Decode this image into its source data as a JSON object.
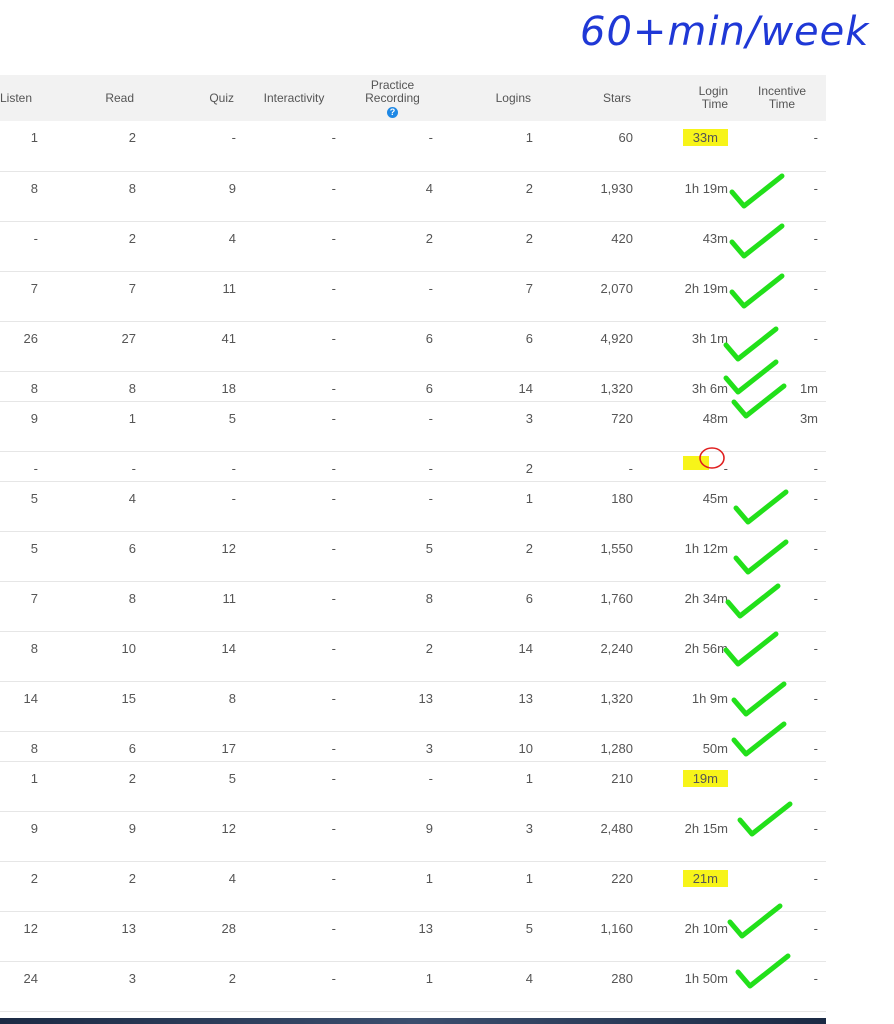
{
  "annotation": {
    "text": "60+min/week",
    "color": "#1f38d6"
  },
  "colors": {
    "highlight": "#f7f419",
    "check": "#22e01a",
    "circle": "#e02020",
    "help": "#1e88e5"
  },
  "columns": {
    "listen": "Listen",
    "read": "Read",
    "quiz": "Quiz",
    "interactivity": "Interactivity",
    "practice_line1": "Practice",
    "practice_line2": "Recording",
    "logins": "Logins",
    "stars": "Stars",
    "login_time_line1": "Login",
    "login_time_line2": "Time",
    "incentive_line1": "Incentive",
    "incentive_line2": "Time"
  },
  "help_icon": "?",
  "rows": [
    {
      "listen": "1",
      "read": "2",
      "quiz": "-",
      "interactivity": "-",
      "practice": "-",
      "logins": "1",
      "stars": "60",
      "login_time": "33m",
      "incentive": "-"
    },
    {
      "listen": "8",
      "read": "8",
      "quiz": "9",
      "interactivity": "-",
      "practice": "4",
      "logins": "2",
      "stars": "1,930",
      "login_time": "1h 19m",
      "incentive": "-"
    },
    {
      "listen": "-",
      "read": "2",
      "quiz": "4",
      "interactivity": "-",
      "practice": "2",
      "logins": "2",
      "stars": "420",
      "login_time": "43m",
      "incentive": "-"
    },
    {
      "listen": "7",
      "read": "7",
      "quiz": "11",
      "interactivity": "-",
      "practice": "-",
      "logins": "7",
      "stars": "2,070",
      "login_time": "2h 19m",
      "incentive": "-"
    },
    {
      "listen": "26",
      "read": "27",
      "quiz": "41",
      "interactivity": "-",
      "practice": "6",
      "logins": "6",
      "stars": "4,920",
      "login_time": "3h 1m",
      "incentive": "-"
    },
    {
      "listen": "8",
      "read": "8",
      "quiz": "18",
      "interactivity": "-",
      "practice": "6",
      "logins": "14",
      "stars": "1,320",
      "login_time": "3h 6m",
      "incentive": "1m"
    },
    {
      "listen": "9",
      "read": "1",
      "quiz": "5",
      "interactivity": "-",
      "practice": "-",
      "logins": "3",
      "stars": "720",
      "login_time": "48m",
      "incentive": "3m"
    },
    {
      "listen": "-",
      "read": "-",
      "quiz": "-",
      "interactivity": "-",
      "practice": "-",
      "logins": "2",
      "stars": "-",
      "login_time": "-",
      "incentive": "-"
    },
    {
      "listen": "5",
      "read": "4",
      "quiz": "-",
      "interactivity": "-",
      "practice": "-",
      "logins": "1",
      "stars": "180",
      "login_time": "45m",
      "incentive": "-"
    },
    {
      "listen": "5",
      "read": "6",
      "quiz": "12",
      "interactivity": "-",
      "practice": "5",
      "logins": "2",
      "stars": "1,550",
      "login_time": "1h 12m",
      "incentive": "-"
    },
    {
      "listen": "7",
      "read": "8",
      "quiz": "11",
      "interactivity": "-",
      "practice": "8",
      "logins": "6",
      "stars": "1,760",
      "login_time": "2h 34m",
      "incentive": "-"
    },
    {
      "listen": "8",
      "read": "10",
      "quiz": "14",
      "interactivity": "-",
      "practice": "2",
      "logins": "14",
      "stars": "2,240",
      "login_time": "2h 56m",
      "incentive": "-"
    },
    {
      "listen": "14",
      "read": "15",
      "quiz": "8",
      "interactivity": "-",
      "practice": "13",
      "logins": "13",
      "stars": "1,320",
      "login_time": "1h 9m",
      "incentive": "-"
    },
    {
      "listen": "8",
      "read": "6",
      "quiz": "17",
      "interactivity": "-",
      "practice": "3",
      "logins": "10",
      "stars": "1,280",
      "login_time": "50m",
      "incentive": "-"
    },
    {
      "listen": "1",
      "read": "2",
      "quiz": "5",
      "interactivity": "-",
      "practice": "-",
      "logins": "1",
      "stars": "210",
      "login_time": "19m",
      "incentive": "-"
    },
    {
      "listen": "9",
      "read": "9",
      "quiz": "12",
      "interactivity": "-",
      "practice": "9",
      "logins": "3",
      "stars": "2,480",
      "login_time": "2h 15m",
      "incentive": "-"
    },
    {
      "listen": "2",
      "read": "2",
      "quiz": "4",
      "interactivity": "-",
      "practice": "1",
      "logins": "1",
      "stars": "220",
      "login_time": "21m",
      "incentive": "-"
    },
    {
      "listen": "12",
      "read": "13",
      "quiz": "28",
      "interactivity": "-",
      "practice": "13",
      "logins": "5",
      "stars": "1,160",
      "login_time": "2h 10m",
      "incentive": "-"
    },
    {
      "listen": "24",
      "read": "3",
      "quiz": "2",
      "interactivity": "-",
      "practice": "1",
      "logins": "4",
      "stars": "280",
      "login_time": "1h 50m",
      "incentive": "-"
    }
  ]
}
